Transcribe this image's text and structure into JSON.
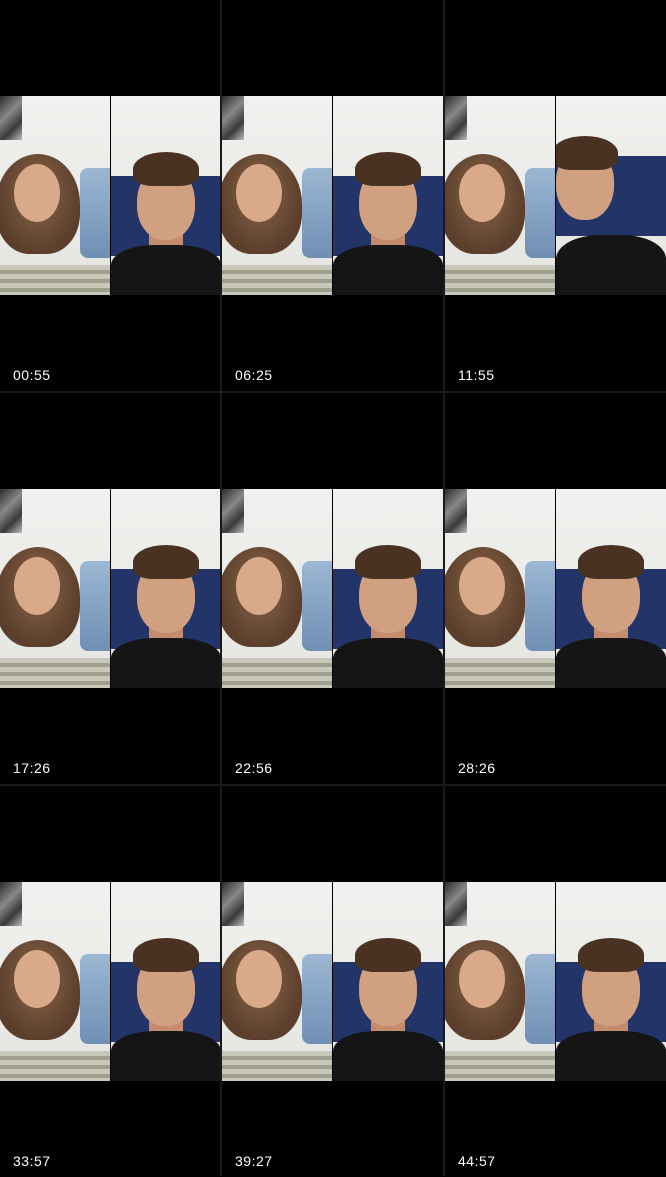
{
  "clips": [
    {
      "time": "00:55"
    },
    {
      "time": "06:25"
    },
    {
      "time": "11:55"
    },
    {
      "time": "17:26"
    },
    {
      "time": "22:56"
    },
    {
      "time": "28:26"
    },
    {
      "time": "33:57"
    },
    {
      "time": "39:27"
    },
    {
      "time": "44:57"
    }
  ]
}
